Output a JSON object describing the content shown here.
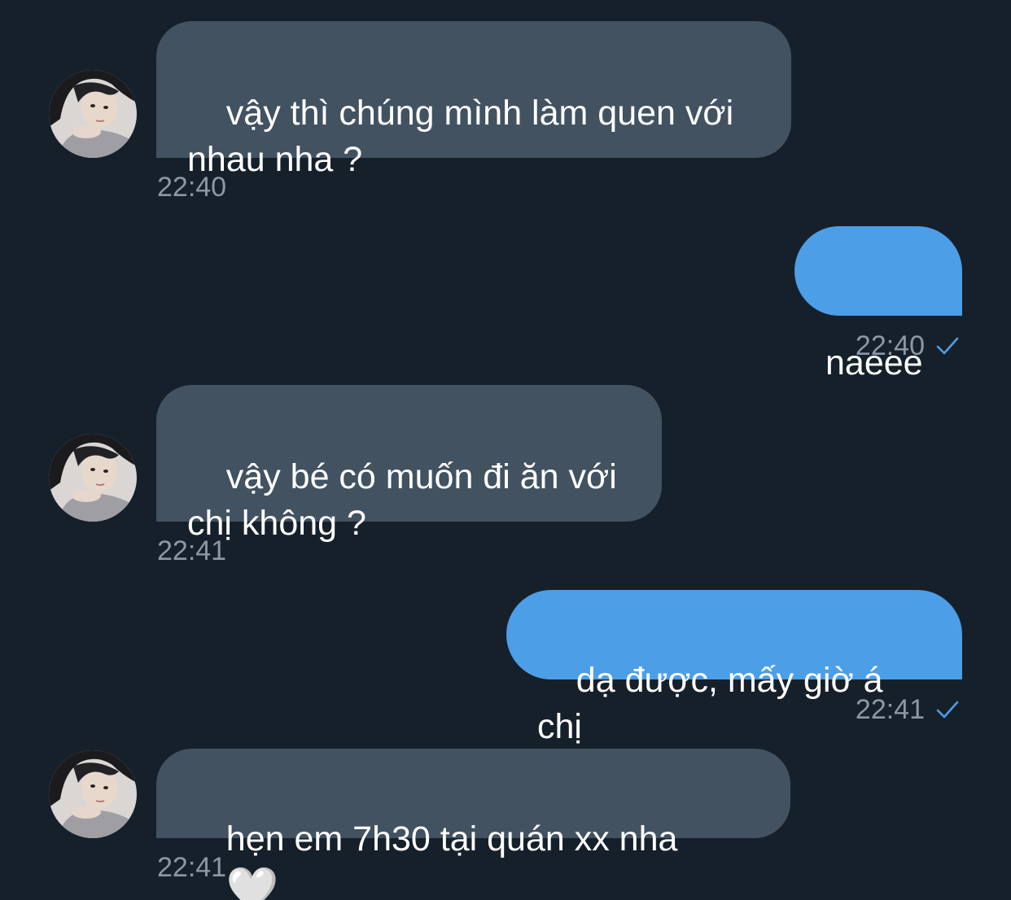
{
  "messages": [
    {
      "direction": "incoming",
      "text": "vậy thì chúng mình làm quen với\nnhau nha ?",
      "time": "22:40"
    },
    {
      "direction": "outgoing",
      "text": "naeee",
      "time": "22:40",
      "status_icon": "check-icon"
    },
    {
      "direction": "incoming",
      "text": "vậy bé có muốn đi ăn với\nchị không ?",
      "time": "22:41"
    },
    {
      "direction": "outgoing",
      "text": "dạ được, mấy giờ á chị",
      "time": "22:41",
      "status_icon": "check-icon"
    },
    {
      "direction": "incoming",
      "text": "hẹn em 7h30 tại quán xx nha",
      "emoji": "🤍",
      "time": "22:41"
    }
  ],
  "colors": {
    "background": "#16202b",
    "incoming_bubble": "#425261",
    "outgoing_bubble": "#4c9ee7",
    "timestamp": "#8b98a5",
    "read_check": "#4c9ee7"
  }
}
